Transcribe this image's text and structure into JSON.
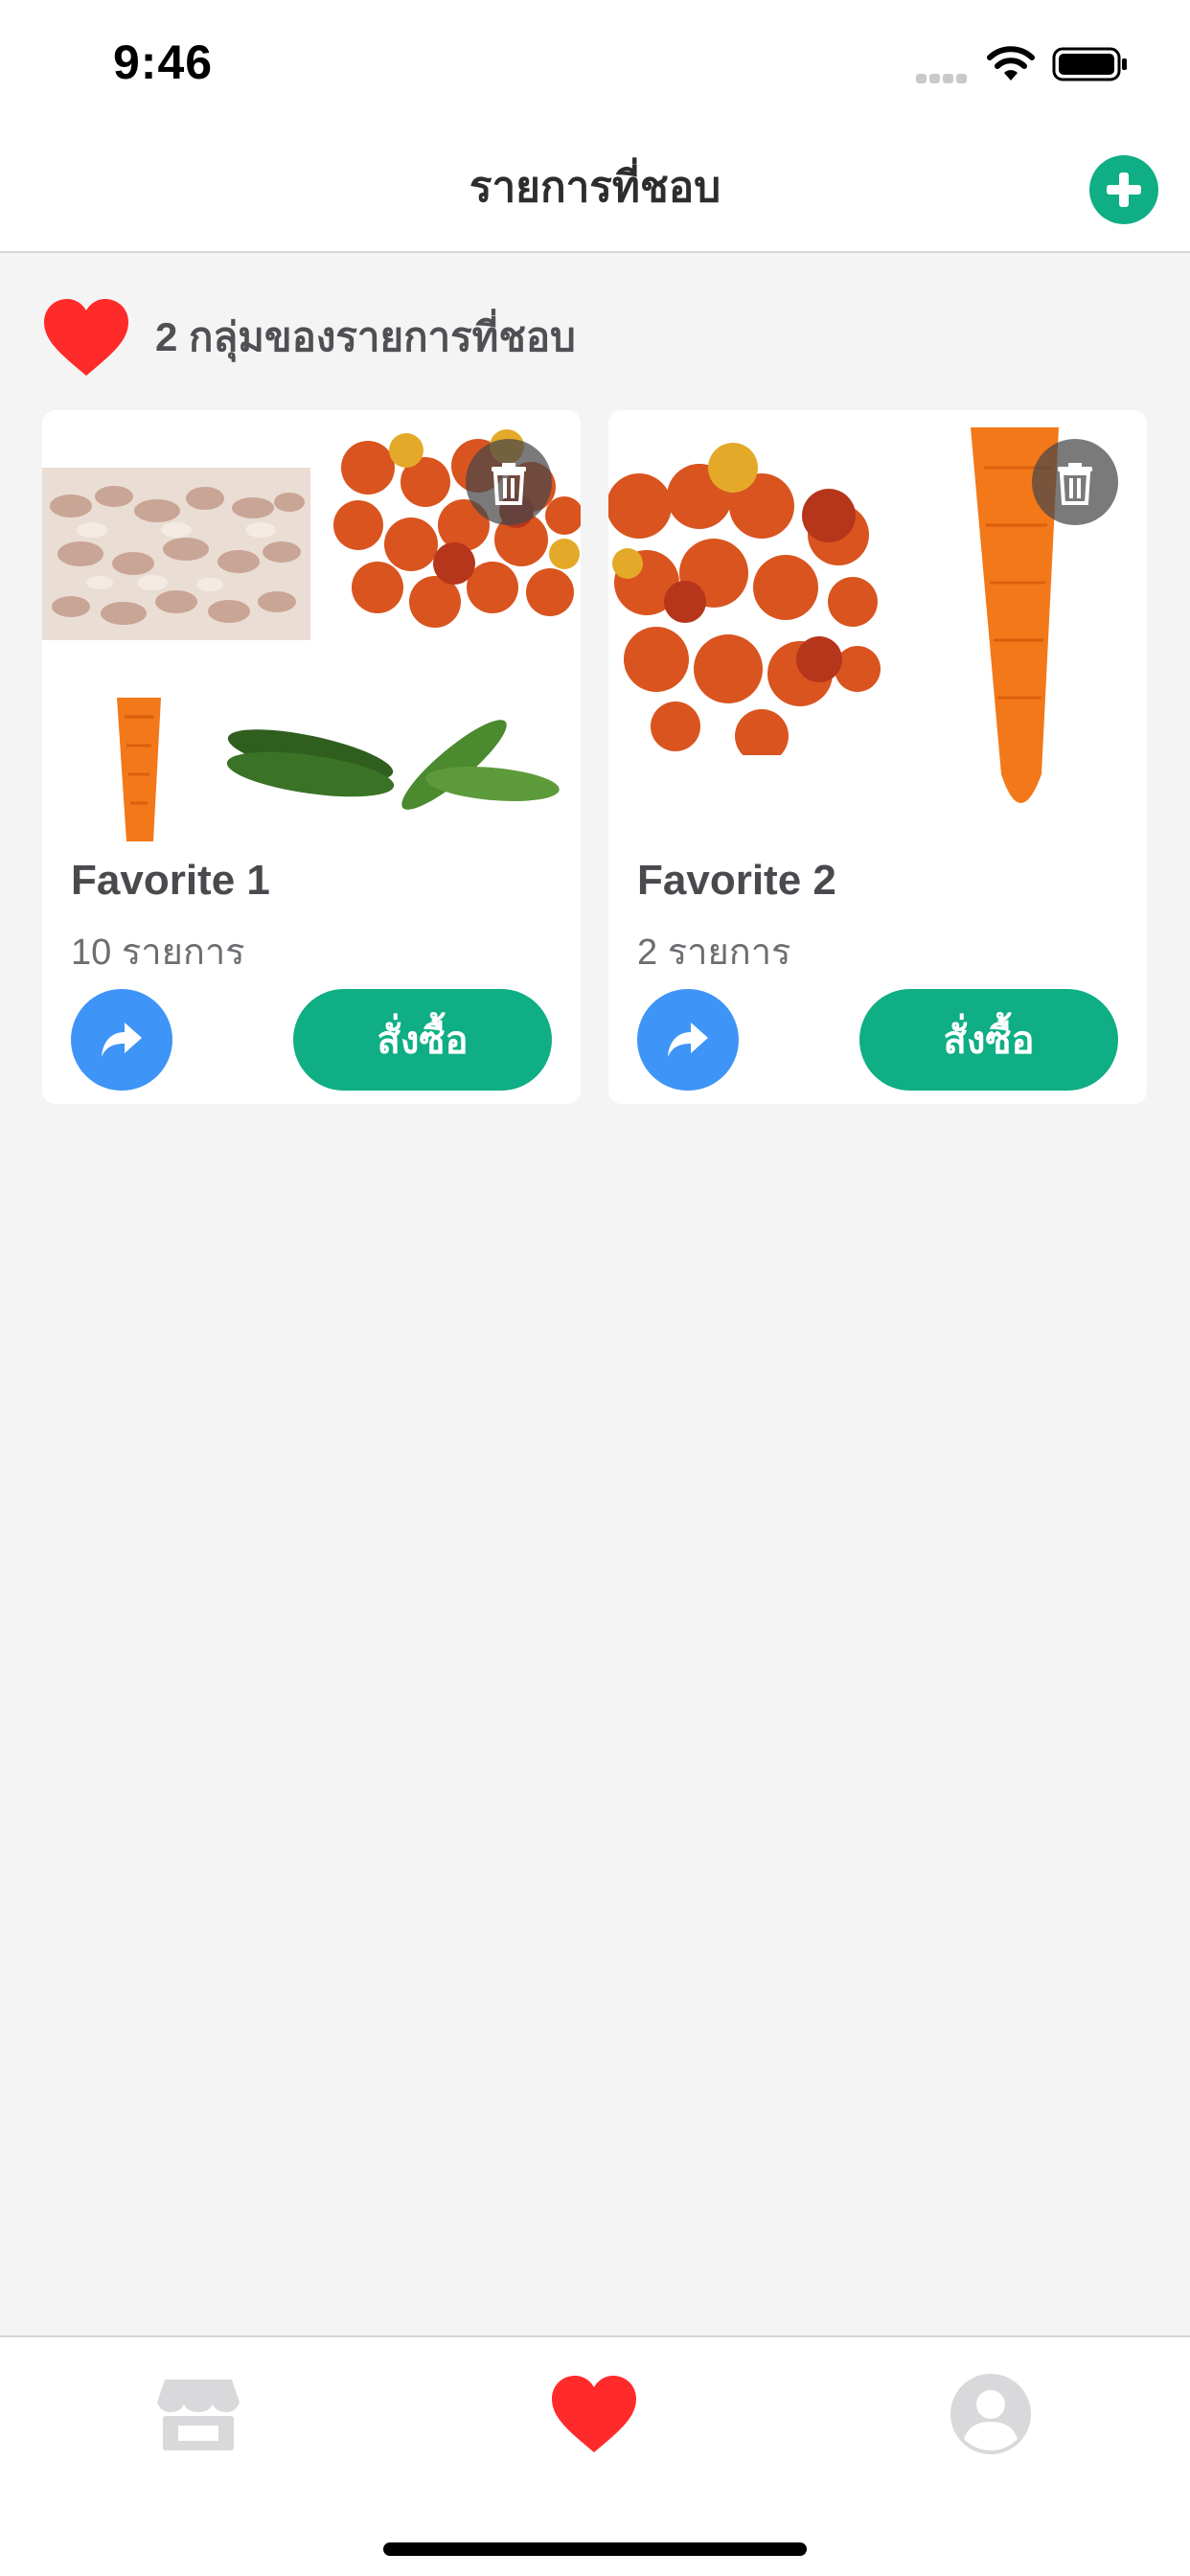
{
  "status_bar": {
    "time": "9:46"
  },
  "header": {
    "title": "รายการที่ชอบ"
  },
  "summary": {
    "group_count_text": "2 กลุ่มของรายการที่ชอบ"
  },
  "favorites": [
    {
      "name": "Favorite 1",
      "item_count_text": "10 รายการ",
      "order_label": "สั่งซื้อ",
      "thumbnails": [
        "garlic",
        "tomatoes",
        "carrot",
        "cucumbers"
      ]
    },
    {
      "name": "Favorite 2",
      "item_count_text": "2 รายการ",
      "order_label": "สั่งซื้อ",
      "thumbnails": [
        "tomatoes",
        "carrot"
      ]
    }
  ],
  "icons": {
    "add": "plus-circle-icon",
    "heart": "heart-icon",
    "delete": "trash-icon",
    "share": "share-arrow-icon",
    "tab_store": "store-icon",
    "tab_favorite": "heart-icon",
    "tab_account": "account-icon"
  },
  "colors": {
    "accent_green": "#0fae85",
    "share_blue": "#3e94f7",
    "heart_red": "#ff2a2a",
    "tab_inactive": "#d9d9db",
    "background": "#f4f4f4"
  },
  "tab_bar": {
    "active_tab": "favorite"
  }
}
